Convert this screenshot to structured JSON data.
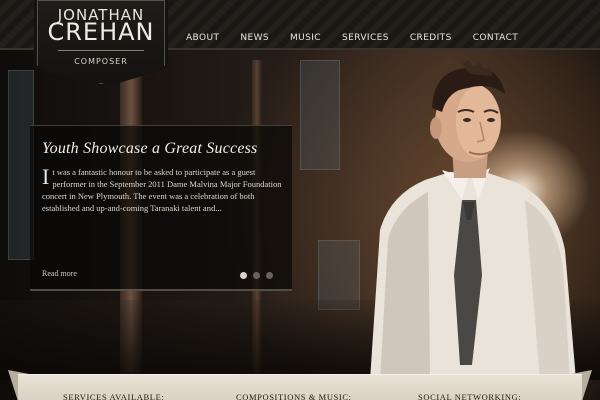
{
  "logo": {
    "first_name": "JONATHAN",
    "last_name": "CREHAN",
    "subtitle": "COMPOSER"
  },
  "nav": {
    "items": [
      "ABOUT",
      "NEWS",
      "MUSIC",
      "SERVICES",
      "CREDITS",
      "CONTACT"
    ]
  },
  "feature": {
    "title": "Youth Showcase a Great Success",
    "dropcap": "I",
    "body": "t was a fantastic honour to be asked to participate as a guest performer in the September 2011 Dame Malvina Major Foundation concert in New Plymouth. The event was a celebration of both established and up-and-coming Taranaki talent and...",
    "read_more": "Read more",
    "slide_count": 3,
    "active_slide": 1
  },
  "footer": {
    "headings": [
      "SERVICES AVAILABLE:",
      "COMPOSITIONS & MUSIC:",
      "SOCIAL NETWORKING:"
    ]
  },
  "colors": {
    "text_light": "#efeae2",
    "banner": "#e9e2d6",
    "nav_bg": "#1a1714"
  }
}
